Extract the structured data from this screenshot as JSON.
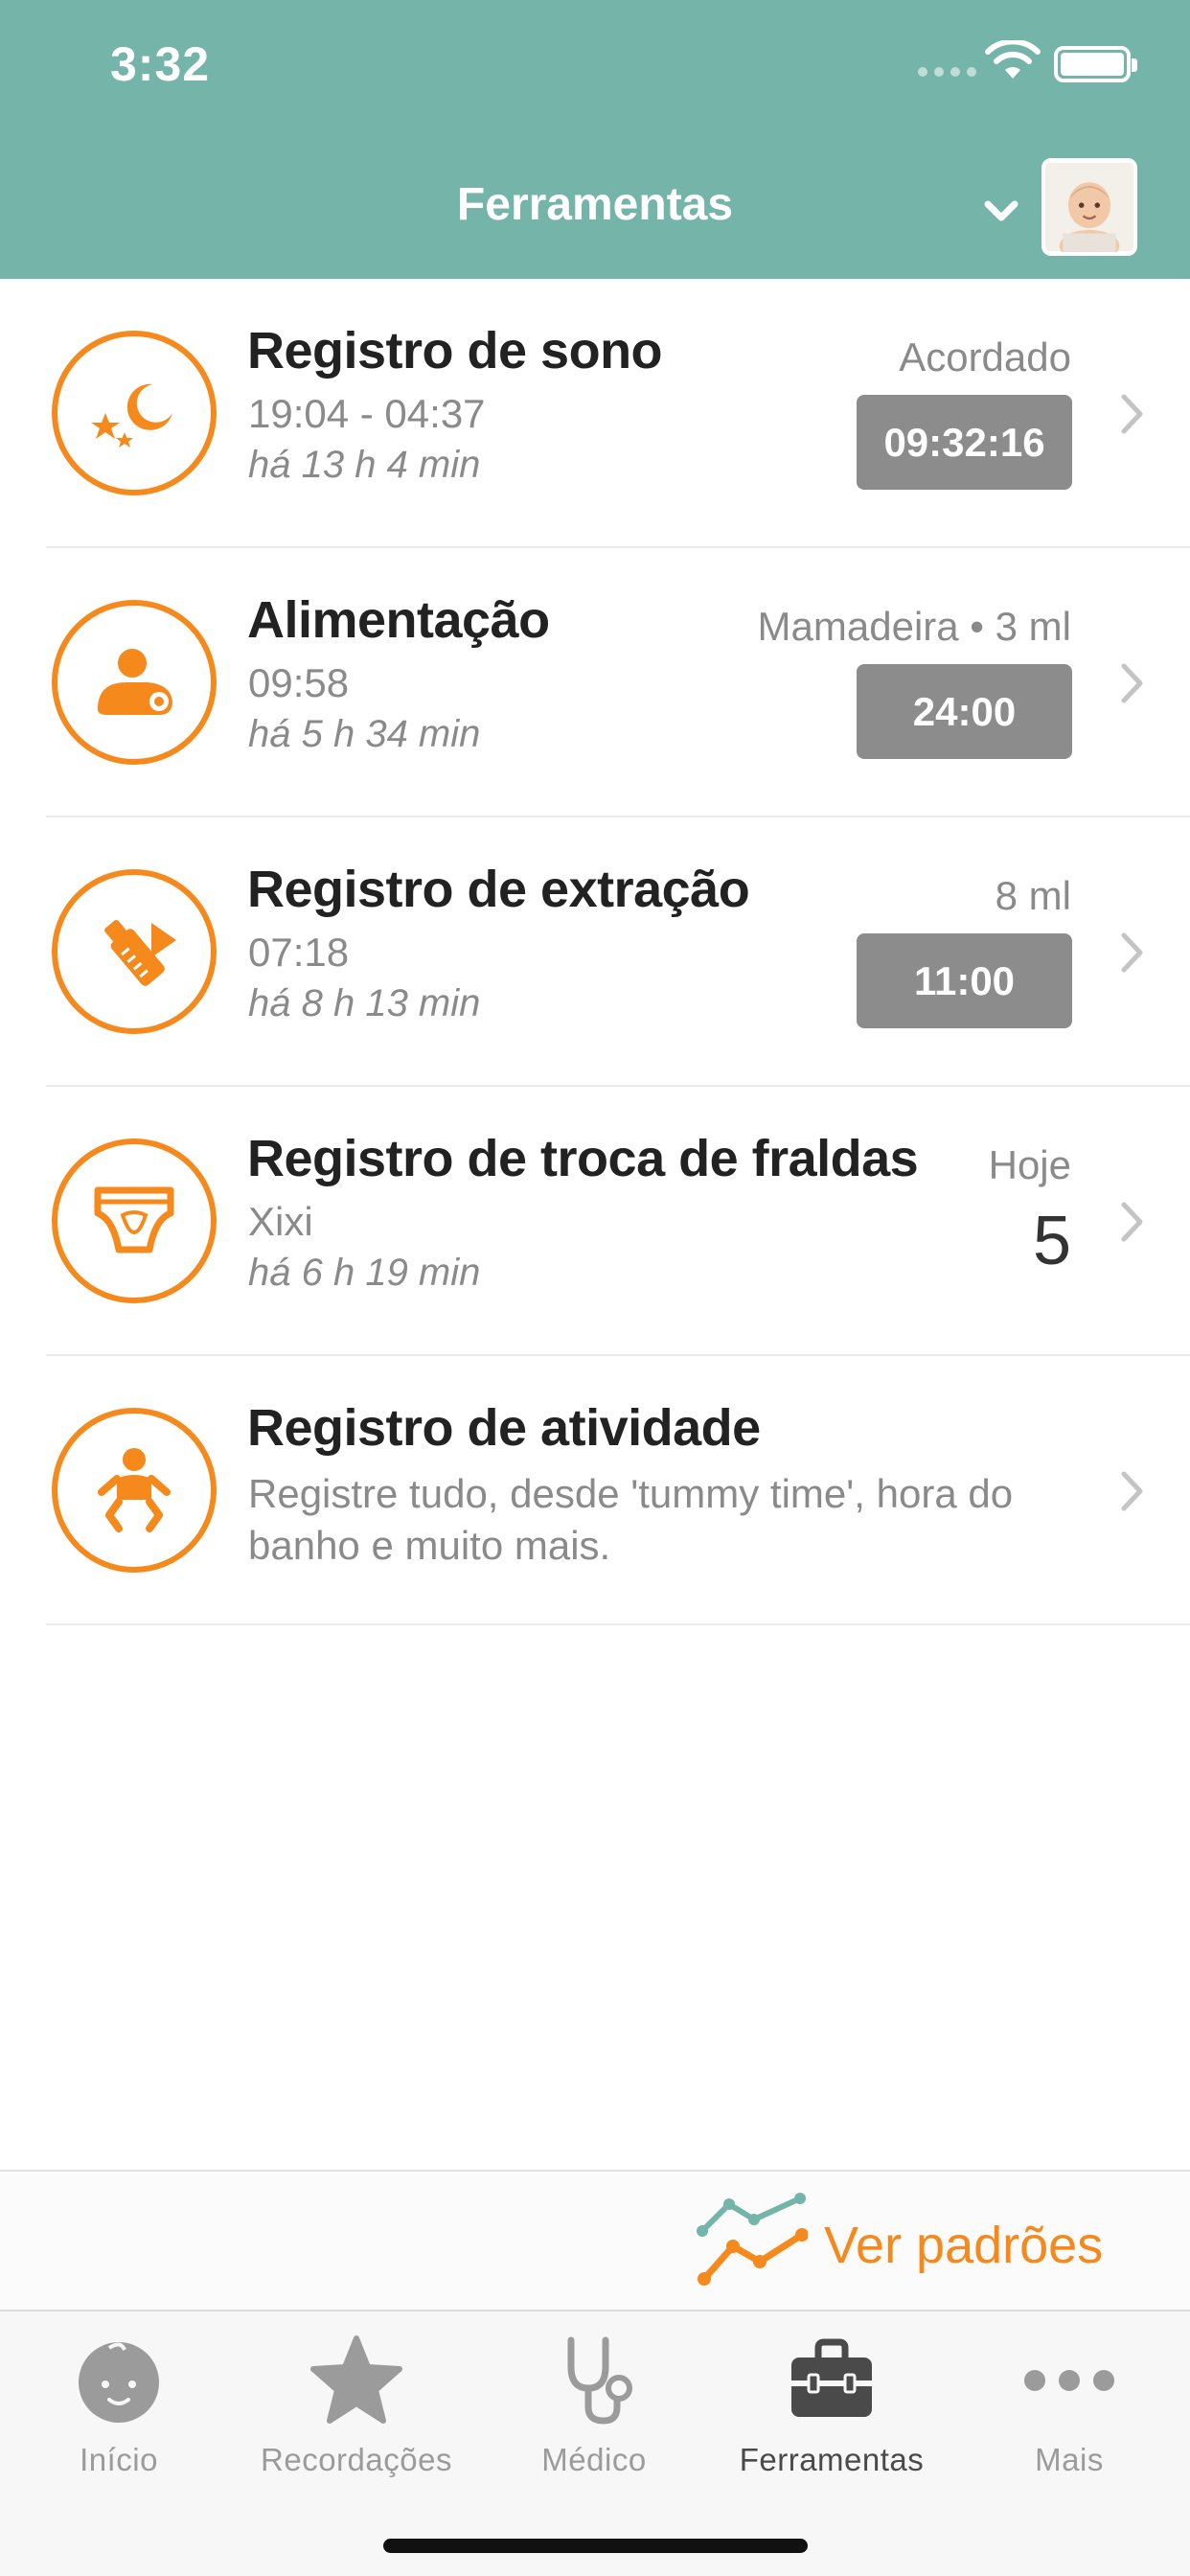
{
  "status_bar": {
    "time": "3:32"
  },
  "header": {
    "title": "Ferramentas"
  },
  "tools": [
    {
      "title": "Registro de sono",
      "line1": "19:04 - 04:37",
      "line2": "há 13 h 4 min",
      "meta": "Acordado",
      "timer": "09:32:16",
      "icon": "moon-stars-icon"
    },
    {
      "title": "Alimentação",
      "line1": "09:58",
      "line2": "há 5 h 34 min",
      "meta": "Mamadeira • 3 ml",
      "timer": "24:00",
      "icon": "feeding-icon"
    },
    {
      "title": "Registro de extração",
      "line1": "07:18",
      "line2": "há 8 h 13 min",
      "meta": "8 ml",
      "timer": "11:00",
      "icon": "breast-pump-icon"
    },
    {
      "title": "Registro de troca de fraldas",
      "line1": "Xixi",
      "line2": "há 6 h 19 min",
      "meta": "Hoje",
      "count": "5",
      "icon": "diaper-icon"
    },
    {
      "title": "Registro de atividade",
      "description": "Registre tudo, desde 'tummy time', hora do banho e muito mais.",
      "icon": "baby-activity-icon"
    }
  ],
  "patterns": {
    "label": "Ver padrões",
    "icon": "trend-lines-icon"
  },
  "tabbar": {
    "active": "Ferramentas",
    "tabs": [
      {
        "label": "Início",
        "icon": "baby-face-icon"
      },
      {
        "label": "Recordações",
        "icon": "star-icon"
      },
      {
        "label": "Médico",
        "icon": "stethoscope-icon"
      },
      {
        "label": "Ferramentas",
        "icon": "toolbox-icon"
      },
      {
        "label": "Mais",
        "icon": "more-dots-icon"
      }
    ]
  },
  "colors": {
    "header": "#74b4a9",
    "accent": "#f5891c",
    "timer": "#8c8c8c"
  }
}
